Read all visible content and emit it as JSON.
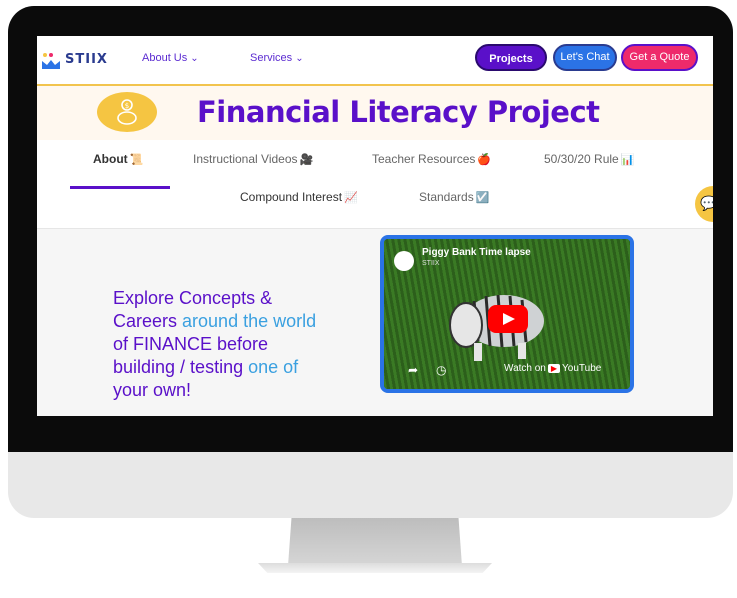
{
  "nav": {
    "logo_text": "STIIX",
    "links": [
      {
        "label": "About Us",
        "chevron": "chevron-down-icon"
      },
      {
        "label": "Services",
        "chevron": "chevron-down-icon"
      }
    ],
    "buttons": {
      "projects": "Projects",
      "chat": "Let's Chat",
      "quote": "Get a Quote"
    }
  },
  "banner": {
    "title": "Financial Literacy Project",
    "icon": "piggy-bank-icon"
  },
  "tabs": [
    {
      "label": "About",
      "emoji": "📜",
      "active": true
    },
    {
      "label": "Instructional Videos",
      "emoji": "🎥",
      "active": false
    },
    {
      "label": "Teacher Resources",
      "emoji": "🍎",
      "active": false
    },
    {
      "label": "50/30/20 Rule",
      "emoji": "📊",
      "active": false
    },
    {
      "label": "Compound Interest",
      "emoji": "📈",
      "active": false
    },
    {
      "label": "Standards",
      "emoji": "☑️",
      "active": false
    }
  ],
  "hero": {
    "line1": "Explore Concepts &",
    "line2a": "Careers ",
    "line2b": "around the world",
    "line3": "of FINANCE before",
    "line4a": "building / testing ",
    "line4b": "one of",
    "line5": "your own!"
  },
  "video": {
    "title": "Piggy Bank Time lapse",
    "channel": "STIIX",
    "watch_on": "Watch on",
    "yt_label": "YouTube"
  },
  "colors": {
    "brand_purple": "#5a10c9",
    "chat_blue": "#2b73e6",
    "quote_pink": "#ee2a6b",
    "banner_gold": "#f5c542"
  }
}
